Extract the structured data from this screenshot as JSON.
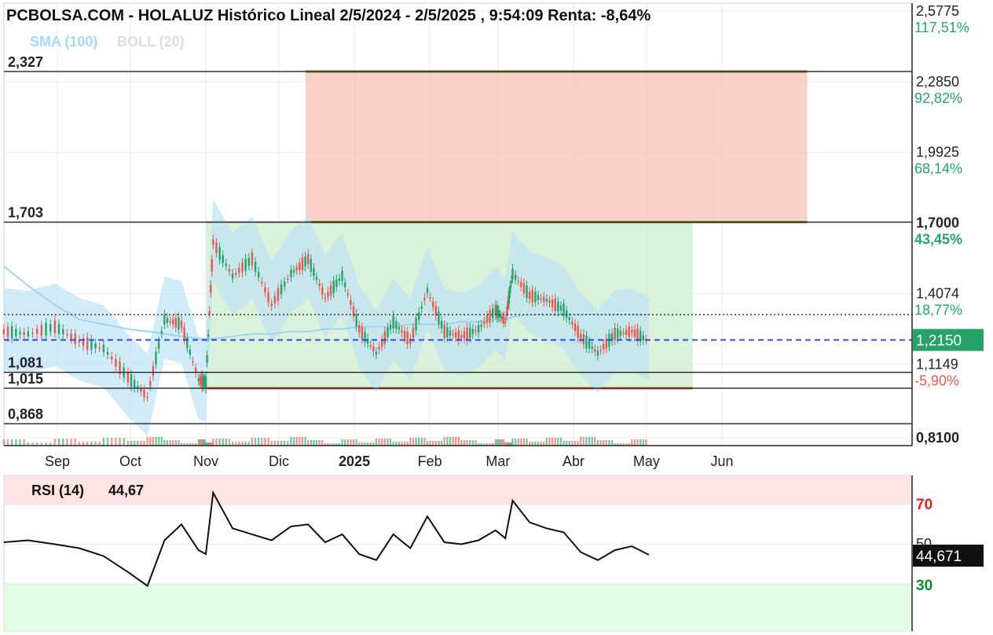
{
  "header": {
    "title": "PCBOLSA.COM - HOLALUZ Histórico Lineal 2/5/2024 - 2/5/2025 , 9:54:09 Renta: -8,64%",
    "sma_label": "SMA (100)",
    "boll_label": "BOLL (20)"
  },
  "colors": {
    "up": "#27a36a",
    "down": "#e25b4d",
    "sma": "#9fd3f2",
    "boll_fill": "#bfe3f5",
    "target_zone": "#f6b8ae",
    "range_zone": "#cdeccd",
    "current_price_bg": "#27a36a",
    "rsi_line": "#111111",
    "rsi_overbought_bg": "#fde3e3",
    "rsi_oversold_bg": "#e2fbe2"
  },
  "price_axis": {
    "ticks": [
      {
        "price": "2,5775",
        "pct": "117,51%",
        "pct_color": "#27a36a"
      },
      {
        "price": "2,2850",
        "pct": "92,82%",
        "pct_color": "#27a36a"
      },
      {
        "price": "1,9925",
        "pct": "68,14%",
        "pct_color": "#27a36a"
      },
      {
        "price": "1,7000",
        "pct": "43,45%",
        "pct_color": "#27a36a"
      },
      {
        "price": "1,4074",
        "pct": "18,77%",
        "pct_color": "#27a36a"
      },
      {
        "price": "1,1149",
        "pct": "-5,90%",
        "pct_color": "#e25b4d"
      },
      {
        "price": "0,8100",
        "pct": "",
        "pct_color": "#27a36a"
      }
    ],
    "current_price": "1,2150"
  },
  "levels": [
    {
      "label": "2,327",
      "value": 2.327
    },
    {
      "label": "1,703",
      "value": 1.703
    },
    {
      "label": "1,081",
      "value": 1.081
    },
    {
      "label": "1,015",
      "value": 1.015
    },
    {
      "label": "0,868",
      "value": 0.868
    }
  ],
  "month_axis": [
    "Sep",
    "Oct",
    "Nov",
    "Dic",
    "2025",
    "Feb",
    "Mar",
    "Abr",
    "May",
    "Jun"
  ],
  "rsi": {
    "title": "RSI (14)",
    "value_text": "44,67",
    "axis_value": "44,671",
    "levels": [
      "70",
      "50",
      "30"
    ]
  },
  "chart_data": {
    "type": "line",
    "title": "PCBOLSA.COM - HOLALUZ Histórico Lineal 2/5/2024 - 2/5/2025 , 9:54:09 Renta: -8,64%",
    "x_range": [
      "2024-08",
      "2025-06"
    ],
    "ylim": [
      0.81,
      2.5775
    ],
    "series": [
      {
        "name": "HOLALUZ",
        "dates": [
          "2024-08-10",
          "2024-08-20",
          "2024-08-31",
          "2024-09-10",
          "2024-09-20",
          "2024-09-30",
          "2024-10-08",
          "2024-10-15",
          "2024-10-22",
          "2024-10-29",
          "2024-11-01",
          "2024-11-04",
          "2024-11-12",
          "2024-11-20",
          "2024-11-28",
          "2024-12-06",
          "2024-12-13",
          "2024-12-20",
          "2024-12-27",
          "2025-01-03",
          "2025-01-10",
          "2025-01-17",
          "2025-01-24",
          "2025-01-31",
          "2025-02-07",
          "2025-02-14",
          "2025-02-21",
          "2025-02-28",
          "2025-03-04",
          "2025-03-07",
          "2025-03-14",
          "2025-03-21",
          "2025-03-28",
          "2025-04-04",
          "2025-04-11",
          "2025-04-18",
          "2025-04-25",
          "2025-05-02"
        ],
        "values": [
          1.25,
          1.24,
          1.27,
          1.21,
          1.18,
          1.06,
          0.98,
          1.3,
          1.28,
          1.05,
          1.04,
          1.62,
          1.48,
          1.55,
          1.36,
          1.49,
          1.55,
          1.39,
          1.48,
          1.26,
          1.16,
          1.29,
          1.21,
          1.42,
          1.25,
          1.23,
          1.26,
          1.34,
          1.29,
          1.49,
          1.4,
          1.38,
          1.34,
          1.23,
          1.16,
          1.24,
          1.25,
          1.21
        ]
      }
    ],
    "rsi_series": {
      "name": "RSI (14)",
      "ylim": [
        0,
        100
      ],
      "values": [
        51,
        52,
        50,
        48,
        44,
        36,
        29,
        52,
        60,
        47,
        45,
        76,
        58,
        55,
        52,
        59,
        60,
        51,
        55,
        45,
        42,
        55,
        48,
        64,
        51,
        50,
        52,
        57,
        53,
        72,
        61,
        58,
        56,
        46,
        42,
        47,
        49,
        44.67
      ]
    },
    "sma_100": [
      1.52,
      1.44,
      1.36,
      1.3,
      1.28,
      1.26,
      1.25,
      1.24,
      1.23,
      1.22,
      1.22,
      1.22,
      1.23,
      1.24,
      1.24,
      1.25,
      1.25,
      1.26,
      1.26,
      1.27,
      1.27,
      1.27,
      1.28,
      1.28,
      1.28,
      1.29,
      1.29,
      1.3,
      1.3,
      1.31,
      1.32,
      1.32,
      1.32,
      1.32,
      1.32,
      1.32,
      1.32,
      1.32
    ],
    "levels": [
      2.327,
      1.703,
      1.081,
      1.015,
      0.868
    ],
    "current_price": 1.215,
    "rsi_levels": [
      70,
      50,
      30
    ]
  }
}
